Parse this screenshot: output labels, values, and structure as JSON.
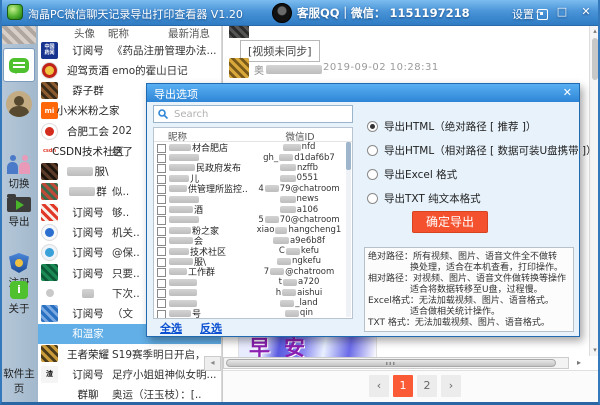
{
  "icons": {
    "close": "✕",
    "minimize": "–",
    "maximize": "□",
    "prev": "‹",
    "next": "›",
    "left": "◂",
    "right": "▸",
    "up": "▴",
    "down": "▾",
    "about_glyph": "i"
  },
  "titlebar": {
    "title": "淘晶PC微信聊天记录导出打印查看器 V1.20",
    "support": "客服QQ｜微信： 1151197218",
    "settings_label": "设置"
  },
  "sidebar": {
    "switch_label": "切换",
    "export_label": "导出",
    "register_label": "注册",
    "about_label": "关于",
    "homepage_label": "软件主页"
  },
  "contacts": {
    "col_avatar": "头像",
    "col_name": "昵称",
    "col_msg": "最新消息",
    "rows": [
      {
        "name": "订阅号",
        "msg": "《药品注册管理办法...",
        "av": {
          "kind": "text",
          "bg": "#16338f",
          "fg": "#ffffff",
          "text": "中国药闻"
        }
      },
      {
        "name": "迎驾贡酒",
        "msg": "emo的霍山日记",
        "av": {
          "kind": "ring",
          "bg": "#c22318",
          "fg": "#f0c342"
        }
      },
      {
        "name": "孬子群",
        "msg": "",
        "av": {
          "kind": "mosaic",
          "c1": "#8a5a30",
          "c2": "#3a2a18"
        }
      },
      {
        "name": "小米米粉之家",
        "msg": "",
        "av": {
          "kind": "text",
          "bg": "#ff6709",
          "fg": "#ffffff",
          "text": "mi"
        }
      },
      {
        "name": "合肥工会",
        "msg": "202",
        "av": {
          "kind": "ring",
          "bg": "#ffffff",
          "fg": "#d42c1e"
        }
      },
      {
        "name": "CSDN技术社区",
        "msg": "绝了",
        "av": {
          "kind": "text",
          "bg": "#ffffff",
          "fg": "#e23c2d",
          "text": "csdn"
        }
      },
      {
        "name": "服\\",
        "mask_w": 26,
        "msg": "",
        "av": {
          "kind": "mosaic",
          "c1": "#5a3a28",
          "c2": "#1d140c"
        }
      },
      {
        "name": "群",
        "mask_w": 26,
        "msg": "似..",
        "av": {
          "kind": "mosaic",
          "c1": "#c04a3a",
          "c2": "#3a6a4a"
        }
      },
      {
        "name": "订阅号",
        "msg": "够..",
        "av": {
          "kind": "mosaic",
          "c1": "#e0392a",
          "c2": "#f8f0e8"
        }
      },
      {
        "name": "订阅号",
        "msg": "机关..",
        "av": {
          "kind": "ring",
          "bg": "#f4f8fc",
          "fg": "#2a6fd0"
        }
      },
      {
        "name": "订阅号",
        "msg": "@保..",
        "av": {
          "kind": "ring",
          "bg": "#eef4fa",
          "fg": "#3aa0d8"
        }
      },
      {
        "name": "订阅号",
        "msg": "只要..",
        "av": {
          "kind": "mosaic",
          "c1": "#1b8a55",
          "c2": "#0d5a38"
        }
      },
      {
        "name": "",
        "mask_w": 12,
        "msg": "下次..",
        "av": {
          "kind": "dot",
          "bg": "#c9c9c9"
        }
      },
      {
        "name": "订阅号",
        "msg": "（文",
        "av": {
          "kind": "mosaic",
          "c1": "#2a70c0",
          "c2": "#7aa8e0"
        }
      },
      {
        "name": "和温家",
        "msg": "",
        "selected": true,
        "av": {
          "kind": "collage",
          "c": [
            "#b08050",
            "#6a8a5a",
            "#c0a080",
            "#4a6a8a"
          ]
        }
      },
      {
        "name": "王者荣耀",
        "msg": "S19赛季明日开启，...",
        "av": {
          "kind": "mosaic",
          "c1": "#c89a3a",
          "c2": "#4a3a1a"
        }
      },
      {
        "name": "订阅号",
        "msg": "足疗小姐姐神似女明...",
        "av": {
          "kind": "text",
          "bg": "#f5f5f5",
          "fg": "#151515",
          "text": "渣"
        }
      },
      {
        "name": "群聊",
        "msg": "奥运（汪玉枝）：[..",
        "av": {
          "kind": "collage",
          "c": [
            "#7a9a4a",
            "#b07a3a",
            "#3a5a2a",
            "#8a6a4a"
          ]
        }
      }
    ]
  },
  "chat": {
    "video_notice": "[视频未同步]",
    "sender_visible": "奥",
    "msg_time": "2019-09-02 10:28:31",
    "image_caption": "早安",
    "pagination": {
      "page1": "1",
      "page2": "2"
    }
  },
  "dialog": {
    "title": "导出选项",
    "search_placeholder": "Search",
    "col_name": "昵称",
    "col_id": "微信ID",
    "rows": [
      {
        "mask_w": 22,
        "name": "材合肥店",
        "id_pre": "",
        "id_mask_w": 18,
        "id_post": "nfd"
      },
      {
        "mask_w": 30,
        "name": "",
        "id_pre": "gh_",
        "id_mask_w": 14,
        "id_post": "d1daf6b7"
      },
      {
        "mask_w": 26,
        "name": "民政府发布",
        "id_pre": "",
        "id_mask_w": 16,
        "id_post": "nzffb"
      },
      {
        "mask_w": 20,
        "name": "儿",
        "id_pre": "",
        "id_mask_w": 16,
        "id_post": "0551"
      },
      {
        "mask_w": 18,
        "name": "供管理所监控..",
        "id_pre": "4",
        "id_mask_w": 14,
        "id_post": "79@chatroom"
      },
      {
        "mask_w": 30,
        "name": "",
        "id_pre": "",
        "id_mask_w": 16,
        "id_post": "news"
      },
      {
        "mask_w": 24,
        "name": "酒",
        "id_pre": "",
        "id_mask_w": 16,
        "id_post": "a106"
      },
      {
        "mask_w": 30,
        "name": "",
        "id_pre": "5",
        "id_mask_w": 14,
        "id_post": "70@chatroom"
      },
      {
        "mask_w": 22,
        "name": "粉之家",
        "id_pre": "xiao",
        "id_mask_w": 12,
        "id_post": "hangcheng1"
      },
      {
        "mask_w": 24,
        "name": "会",
        "id_pre": "",
        "id_mask_w": 16,
        "id_post": "a9e6b8f"
      },
      {
        "mask_w": 20,
        "name": "技术社区",
        "id_pre": "C",
        "id_mask_w": 14,
        "id_post": "kefu"
      },
      {
        "mask_w": 24,
        "name": "服\\",
        "id_pre": "",
        "id_mask_w": 14,
        "id_post": "ngkefu"
      },
      {
        "mask_w": 18,
        "name": "工作群",
        "id_pre": "7",
        "id_mask_w": 14,
        "id_post": "@chatroom"
      },
      {
        "mask_w": 28,
        "name": "",
        "id_pre": "t",
        "id_mask_w": 14,
        "id_post": "a720"
      },
      {
        "mask_w": 28,
        "name": "",
        "id_pre": "h",
        "id_mask_w": 14,
        "id_post": "aishui"
      },
      {
        "mask_w": 28,
        "name": "",
        "id_pre": "",
        "id_mask_w": 14,
        "id_post": "_land"
      },
      {
        "mask_w": 22,
        "name": "号",
        "id_pre": "",
        "id_mask_w": 14,
        "id_post": "qin"
      }
    ],
    "select_all": "全选",
    "invert_select": "反选",
    "options": [
      {
        "label": "导出HTML（绝对路径 [ 推荐 ]）",
        "selected": true
      },
      {
        "label": "导出HTML（相对路径 [ 数据可装U盘携带 ]）",
        "selected": false
      },
      {
        "label": "导出Excel 格式",
        "selected": false
      },
      {
        "label": "导出TXT 纯文本格式",
        "selected": false
      }
    ],
    "export_button": "确定导出",
    "notes": [
      "绝对路径：所有视频、图片、语音文件全不做转",
      "换处理，适合在本机查看，打印操作。",
      "相对路径：对视频、图片、语音文件做转换等操作",
      "适合将数据转移至U盘，过程慢。",
      "Excel格式：无法加载视频、图片、语音格式。",
      "适合做相关统计操作。",
      "TXT 格式：无法加载视频、图片、语音格式。"
    ]
  },
  "colors": {
    "accent_orange": "#f4512e",
    "titlebar_blue": "#3f8ed6",
    "link_blue": "#0a50d0",
    "selected_row": "#62aee6"
  }
}
